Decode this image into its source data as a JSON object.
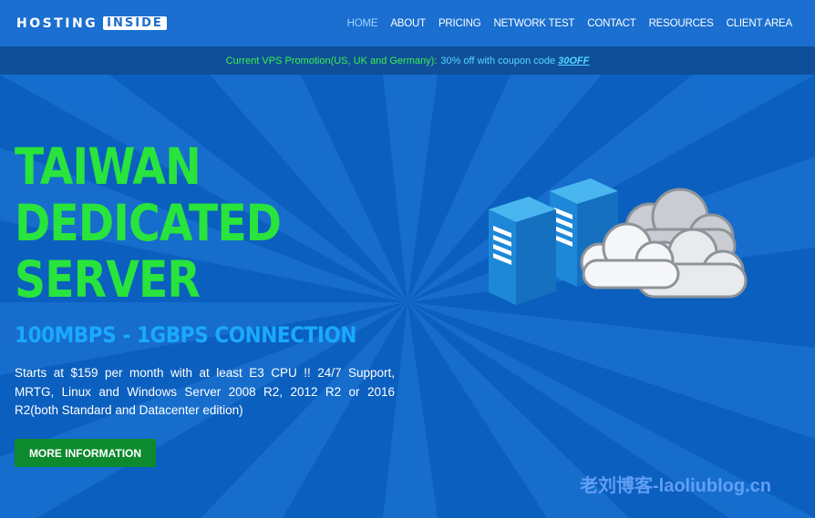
{
  "brand": {
    "logo_text": "HOSTING",
    "logo_box": "INSIDE"
  },
  "nav": {
    "items": [
      {
        "label": "HOME"
      },
      {
        "label": "ABOUT"
      },
      {
        "label": "PRICING"
      },
      {
        "label": "NETWORK TEST"
      },
      {
        "label": "CONTACT"
      },
      {
        "label": "RESOURCES"
      },
      {
        "label": "CLIENT AREA"
      }
    ]
  },
  "promo": {
    "text": "Current VPS Promotion(US, UK and Germany):",
    "offer": "30% off with coupon code",
    "code": "30OFF"
  },
  "hero": {
    "title_lines": [
      "TAIWAN",
      "DEDICATED",
      "SERVER"
    ],
    "subtitle": "100MBPS - 1GBPS CONNECTION",
    "description": "Starts at $159 per month with at least E3 CPU !! 24/7 Support, MRTG, Linux and Windows Server 2008 R2, 2012 R2 or 2016 R2(both Standard and Datacenter edition)",
    "button_label": "MORE INFORMATION"
  },
  "watermark": "老刘博客-laoliublog.cn",
  "icons": [
    "server-icon",
    "cloud-icon"
  ],
  "colors": {
    "header_bg": "#1a6fd0",
    "promo_bg": "#0f4f9a",
    "hero_bg": "#0b5fbe",
    "title_green": "#28e43c",
    "subtitle_blue": "#1aa9ff",
    "button_green": "#0d8a2e"
  }
}
